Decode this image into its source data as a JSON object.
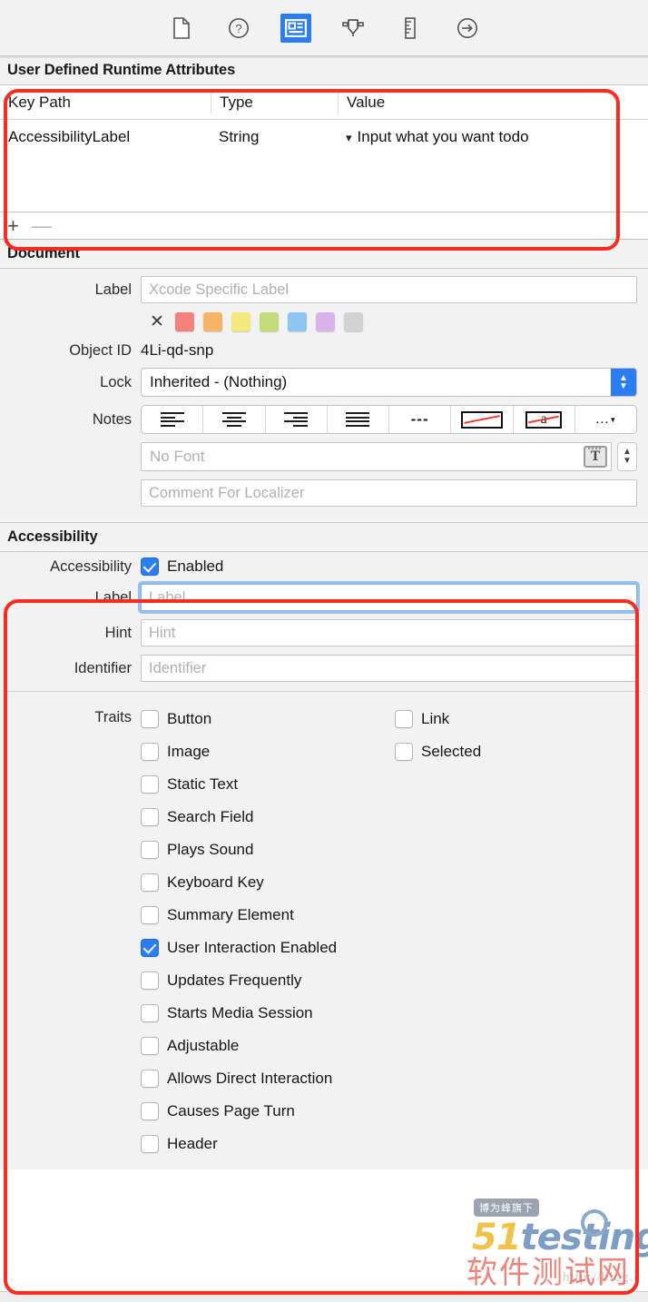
{
  "toolbar": {
    "icons": [
      {
        "name": "file-inspector-icon",
        "label": "File inspector",
        "selected": false
      },
      {
        "name": "quick-help-icon",
        "label": "Quick Help inspector",
        "selected": false
      },
      {
        "name": "identity-inspector-icon",
        "label": "Identity inspector",
        "selected": true
      },
      {
        "name": "attributes-inspector-icon",
        "label": "Attributes inspector",
        "selected": false
      },
      {
        "name": "size-inspector-icon",
        "label": "Size inspector",
        "selected": false
      },
      {
        "name": "connections-inspector-icon",
        "label": "Connections inspector",
        "selected": false
      }
    ],
    "selected_accent": "#2a7ef2"
  },
  "runtime_attributes": {
    "title": "User Defined Runtime Attributes",
    "columns": [
      "Key Path",
      "Type",
      "Value"
    ],
    "rows": [
      {
        "key_path": "AccessibilityLabel",
        "type": "String",
        "value": "Input what you want todo"
      }
    ],
    "add_label": "+",
    "remove_label": "—"
  },
  "document": {
    "title": "Document",
    "label_row_label": "Label",
    "label_placeholder": "Xcode Specific Label",
    "label_value": "",
    "swatch_clear": "✕",
    "swatches": [
      "#f4817b",
      "#f5b565",
      "#f3e97f",
      "#c2dc77",
      "#8dc5f2",
      "#d9b3ea",
      "#d2d2d2"
    ],
    "object_id_label": "Object ID",
    "object_id_value": "4Li-qd-snp",
    "lock_label": "Lock",
    "lock_value": "Inherited - (Nothing)",
    "notes_label": "Notes",
    "notes_segments": [
      "align-left-icon",
      "align-center-icon",
      "align-right-icon",
      "align-justify-icon",
      "dashes-icon",
      "no-color-box-icon",
      "no-font-a-icon",
      "more-options-icon"
    ],
    "notes_dashes_text": "---",
    "notes_a_text": "a",
    "notes_more_text": "…",
    "font_placeholder": "No Font",
    "font_value": "",
    "comment_placeholder": "Comment For Localizer",
    "comment_value": ""
  },
  "accessibility": {
    "title": "Accessibility",
    "enabled_row_label": "Accessibility",
    "enabled_label": "Enabled",
    "enabled_checked": true,
    "fields": [
      {
        "label": "Label",
        "placeholder": "Label",
        "value": "",
        "focused": true
      },
      {
        "label": "Hint",
        "placeholder": "Hint",
        "value": "",
        "focused": false
      },
      {
        "label": "Identifier",
        "placeholder": "Identifier",
        "value": "",
        "focused": false
      }
    ],
    "traits_label": "Traits",
    "traits_left": [
      {
        "label": "Button",
        "checked": false
      },
      {
        "label": "Image",
        "checked": false
      },
      {
        "label": "Static Text",
        "checked": false
      },
      {
        "label": "Search Field",
        "checked": false
      },
      {
        "label": "Plays Sound",
        "checked": false
      },
      {
        "label": "Keyboard Key",
        "checked": false
      },
      {
        "label": "Summary Element",
        "checked": false
      },
      {
        "label": "User Interaction Enabled",
        "checked": true
      },
      {
        "label": "Updates Frequently",
        "checked": false
      },
      {
        "label": "Starts Media Session",
        "checked": false
      },
      {
        "label": "Adjustable",
        "checked": false
      },
      {
        "label": "Allows Direct Interaction",
        "checked": false
      },
      {
        "label": "Causes Page Turn",
        "checked": false
      },
      {
        "label": "Header",
        "checked": false
      }
    ],
    "traits_right": [
      {
        "label": "Link",
        "checked": false
      },
      {
        "label": "Selected",
        "checked": false
      }
    ]
  },
  "watermark": {
    "badge": "博为峰旗下",
    "logo_51": "51",
    "logo_testing": "testing",
    "chinese": "软件测试网",
    "url": "http://blog.c"
  },
  "highlight_color": "#fc2b20"
}
